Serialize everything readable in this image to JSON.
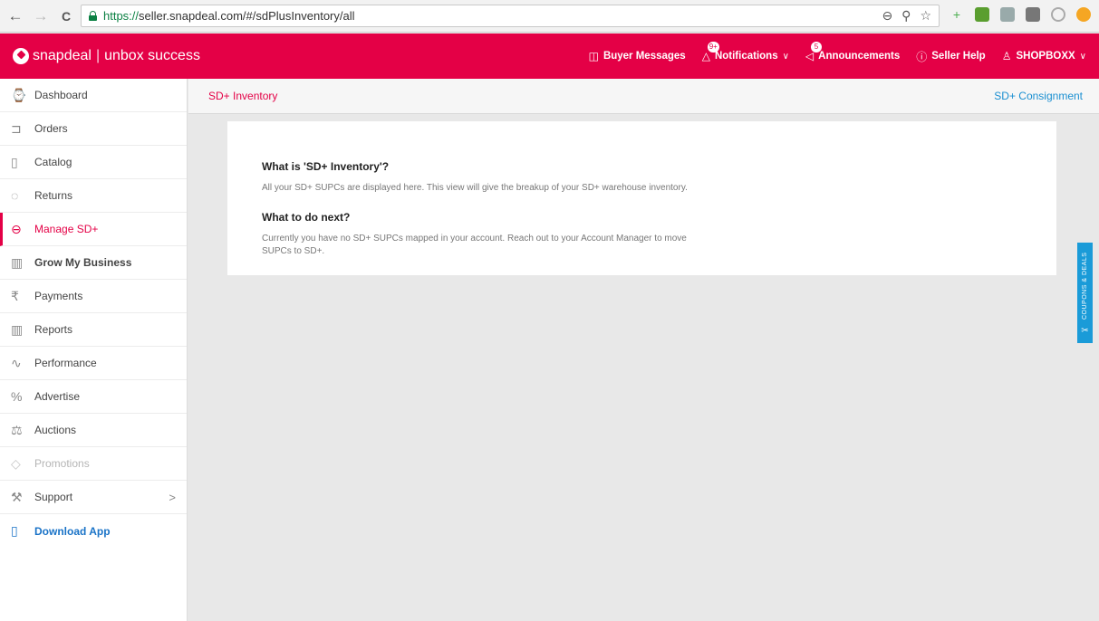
{
  "browser": {
    "back_icon": "←",
    "forward_icon": "→",
    "reload_icon": "C",
    "url_https": "https://",
    "url_rest": "seller.snapdeal.com/#/sdPlusInventory/all",
    "addr_icons": [
      "⊖",
      "⚲",
      "☆"
    ]
  },
  "header": {
    "brand": "snapdeal",
    "separator": "|",
    "tagline": "unbox success",
    "links": {
      "buyer_messages": "Buyer Messages",
      "notifications": "Notifications",
      "notifications_badge": "9+",
      "announcements": "Announcements",
      "announcements_badge": "5",
      "seller_help": "Seller Help",
      "account": "SHOPBOXX"
    }
  },
  "sidebar": {
    "items": [
      {
        "label": "Dashboard",
        "icon": "⌚"
      },
      {
        "label": "Orders",
        "icon": "⊐"
      },
      {
        "label": "Catalog",
        "icon": "▯"
      },
      {
        "label": "Returns",
        "icon": "◌"
      },
      {
        "label": "Manage SD+",
        "icon": "⊖"
      },
      {
        "label": "Grow My Business",
        "icon": "▥"
      },
      {
        "label": "Payments",
        "icon": "₹"
      },
      {
        "label": "Reports",
        "icon": "▥"
      },
      {
        "label": "Performance",
        "icon": "∿"
      },
      {
        "label": "Advertise",
        "icon": "%"
      },
      {
        "label": "Auctions",
        "icon": "⚖"
      },
      {
        "label": "Promotions",
        "icon": "◇"
      },
      {
        "label": "Support",
        "icon": "⚒",
        "arrow": ">"
      },
      {
        "label": "Download App",
        "icon": "▯"
      }
    ]
  },
  "subheader": {
    "title": "SD+ Inventory",
    "right_link": "SD+ Consignment"
  },
  "content": {
    "what_title": "What is 'SD+ Inventory'?",
    "what_text": "All your SD+ SUPCs are displayed here. This view will give the breakup of your SD+ warehouse inventory.",
    "next_title": "What to do next?",
    "next_text": "Currently you have no SD+ SUPCs mapped in your account. Reach out to your Account Manager to move SUPCs to SD+."
  },
  "coupons_tab": {
    "label": "COUPONS & DEALS",
    "icon": "✂"
  }
}
